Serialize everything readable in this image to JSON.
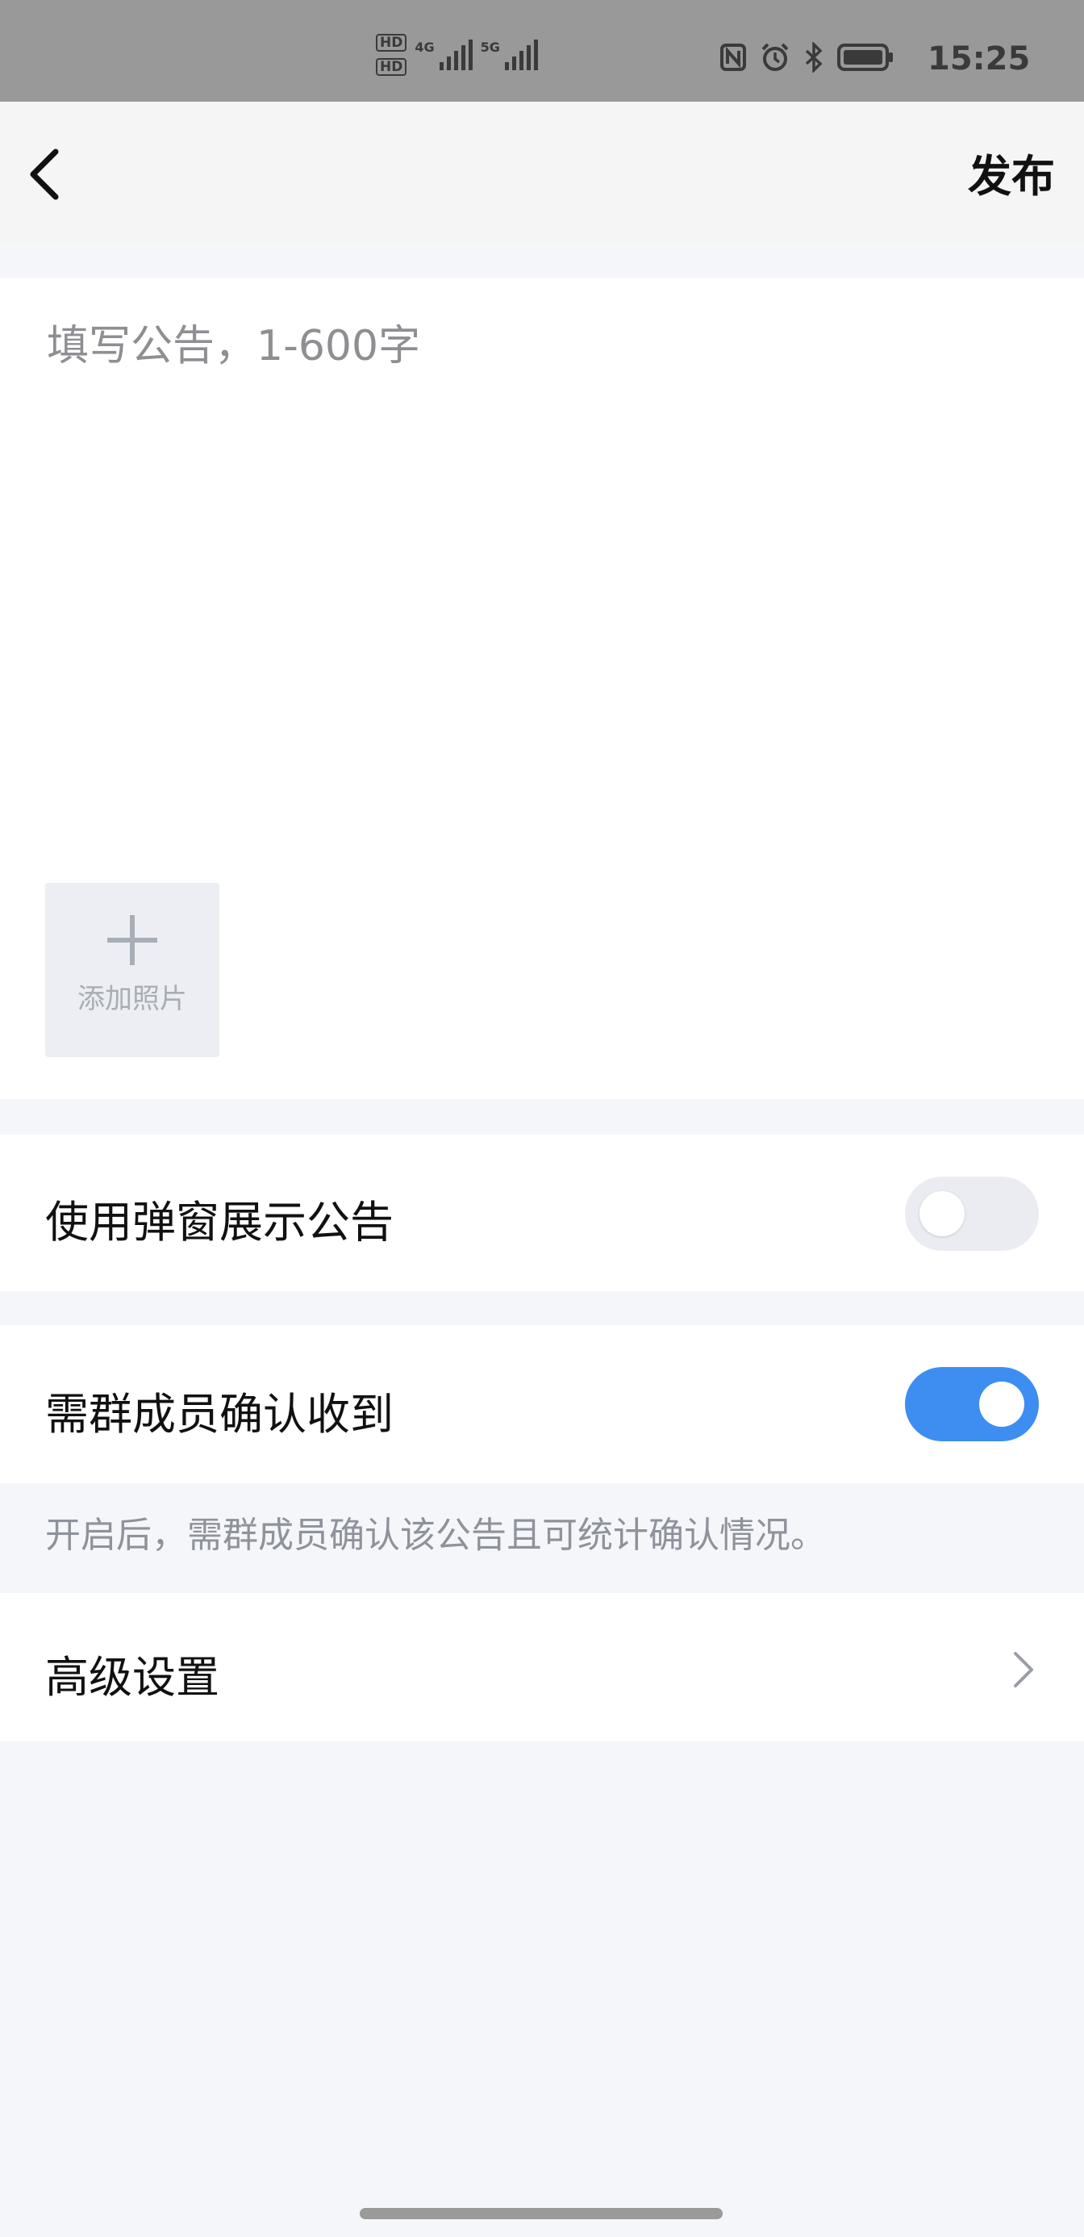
{
  "status_bar": {
    "time": "15:25",
    "sim1_label": "HD",
    "sim2_label": "HD",
    "net1": "4G",
    "net2": "5G"
  },
  "header": {
    "publish_label": "发布"
  },
  "editor": {
    "placeholder": "填写公告，1-600字",
    "value": "",
    "add_photo_label": "添加照片"
  },
  "settings": {
    "popup_label": "使用弹窗展示公告",
    "popup_enabled": false,
    "confirm_label": "需群成员确认收到",
    "confirm_enabled": true,
    "confirm_hint": "开启后，需群成员确认该公告且可统计确认情况。",
    "advanced_label": "高级设置"
  },
  "colors": {
    "toggle_on": "#3d8ef0",
    "toggle_off": "#eaecf1",
    "page_bg": "#f5f6f9"
  }
}
